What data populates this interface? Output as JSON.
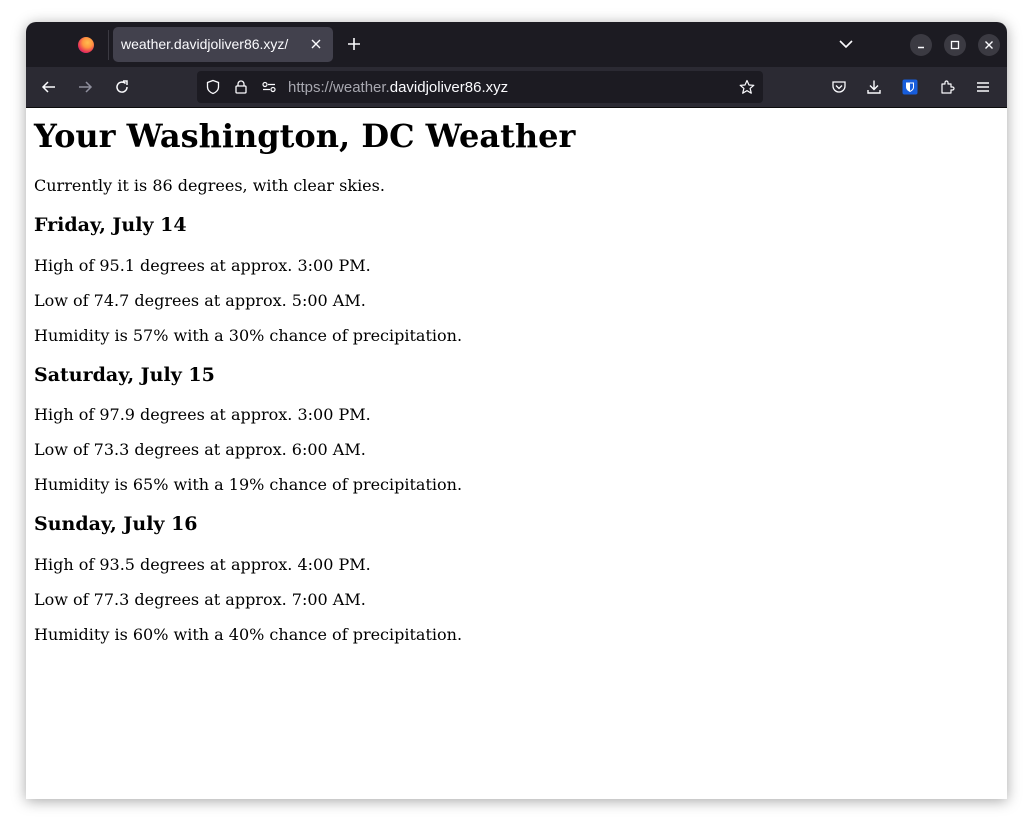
{
  "browser": {
    "tab_title": "weather.davidjoliver86.xyz/",
    "url_prefix": "https://weather.",
    "url_domain": "davidjoliver86.xyz"
  },
  "page": {
    "heading": "Your Washington, DC Weather",
    "current": "Currently it is 86 degrees, with clear skies.",
    "days": [
      {
        "title": "Friday, July 14",
        "high": "High of 95.1 degrees at approx. 3:00 PM.",
        "low": "Low of 74.7 degrees at approx. 5:00 AM.",
        "humidity": "Humidity is 57% with a 30% chance of precipitation."
      },
      {
        "title": "Saturday, July 15",
        "high": "High of 97.9 degrees at approx. 3:00 PM.",
        "low": "Low of 73.3 degrees at approx. 6:00 AM.",
        "humidity": "Humidity is 65% with a 19% chance of precipitation."
      },
      {
        "title": "Sunday, July 16",
        "high": "High of 93.5 degrees at approx. 4:00 PM.",
        "low": "Low of 77.3 degrees at approx. 7:00 AM.",
        "humidity": "Humidity is 60% with a 40% chance of precipitation."
      }
    ]
  }
}
